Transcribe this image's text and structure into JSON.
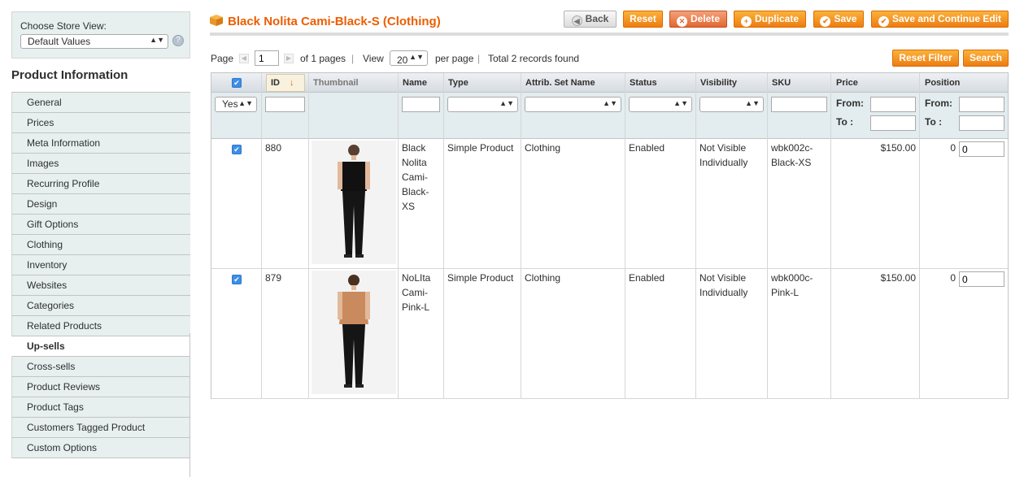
{
  "store": {
    "label": "Choose Store View:",
    "selected": "Default Values",
    "help_icon": "help-icon"
  },
  "sidebar": {
    "title": "Product Information",
    "items": [
      {
        "label": "General"
      },
      {
        "label": "Prices"
      },
      {
        "label": "Meta Information"
      },
      {
        "label": "Images"
      },
      {
        "label": "Recurring Profile"
      },
      {
        "label": "Design"
      },
      {
        "label": "Gift Options"
      },
      {
        "label": "Clothing"
      },
      {
        "label": "Inventory"
      },
      {
        "label": "Websites"
      },
      {
        "label": "Categories"
      },
      {
        "label": "Related Products"
      },
      {
        "label": "Up-sells",
        "active": true
      },
      {
        "label": "Cross-sells"
      },
      {
        "label": "Product Reviews"
      },
      {
        "label": "Product Tags"
      },
      {
        "label": "Customers Tagged Product"
      },
      {
        "label": "Custom Options"
      }
    ]
  },
  "header": {
    "title": "Black Nolita Cami-Black-S (Clothing)",
    "buttons": {
      "back": "Back",
      "reset": "Reset",
      "delete": "Delete",
      "duplicate": "Duplicate",
      "save": "Save",
      "save_continue": "Save and Continue Edit"
    }
  },
  "pager": {
    "page_label": "Page",
    "page_value": "1",
    "of_pages": "of 1 pages",
    "separator": "|",
    "view_label": "View",
    "view_value": "20",
    "per_page": "per page",
    "total": "Total 2 records found",
    "reset_filter": "Reset Filter",
    "search": "Search"
  },
  "grid": {
    "columns": {
      "id": "ID",
      "thumbnail": "Thumbnail",
      "name": "Name",
      "type": "Type",
      "attrib_set": "Attrib. Set Name",
      "status": "Status",
      "visibility": "Visibility",
      "sku": "SKU",
      "price": "Price",
      "position": "Position"
    },
    "filter": {
      "in_products": "Yes",
      "price_from": "From:",
      "price_to": "To :",
      "position_from": "From:",
      "position_to": "To :"
    },
    "rows": [
      {
        "id": "880",
        "name_lines": [
          "Black",
          "Nolita",
          "Cami-",
          "Black-",
          "XS"
        ],
        "type": "Simple Product",
        "attrib_set": "Clothing",
        "status": "Enabled",
        "visibility_lines": [
          "Not Visible",
          "Individually"
        ],
        "sku_lines": [
          "wbk002c-",
          "Black-XS"
        ],
        "price": "$150.00",
        "position_text": "0",
        "position_value": "0",
        "thumb_color": "#1a1a1a"
      },
      {
        "id": "879",
        "name_lines": [
          "NoLIta",
          "Cami-",
          "Pink-L"
        ],
        "type": "Simple Product",
        "attrib_set": "Clothing",
        "status": "Enabled",
        "visibility_lines": [
          "Not Visible",
          "Individually"
        ],
        "sku_lines": [
          "wbk000c-",
          "Pink-L"
        ],
        "price": "$150.00",
        "position_text": "0",
        "position_value": "0",
        "thumb_color": "#c98a5e"
      }
    ]
  },
  "colors": {
    "accent": "#eb5e00",
    "button_orange": "#ed7d13",
    "tab_bg": "#e7efef",
    "checkbox_blue": "#3d8fe6"
  }
}
